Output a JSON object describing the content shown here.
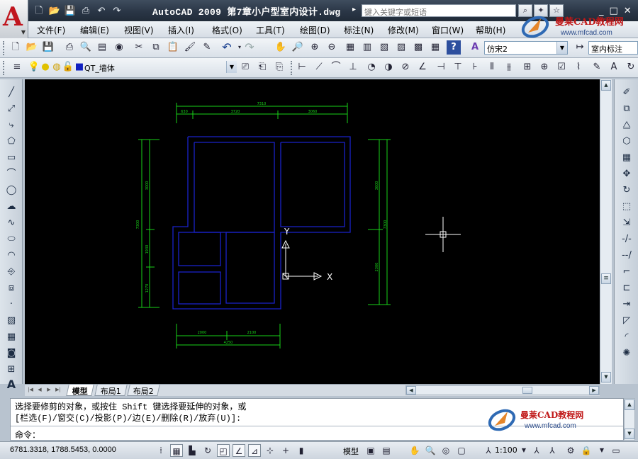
{
  "window": {
    "title": "AutoCAD  2009  第7章小户型室内设计.dwg",
    "search_placeholder": "键入关键字或短语",
    "controls": [
      "_",
      "□",
      "✕"
    ]
  },
  "menu": {
    "items": [
      "文件(F)",
      "编辑(E)",
      "视图(V)",
      "插入(I)",
      "格式(O)",
      "工具(T)",
      "绘图(D)",
      "标注(N)",
      "修改(M)",
      "窗口(W)",
      "帮助(H)"
    ]
  },
  "toolbars": {
    "font_combo": "仿宋2",
    "dimstyle_combo": "室内标注",
    "layer_combo": "QT_墙体"
  },
  "drawing": {
    "dim_top_total": "7310",
    "dim_top_parts": [
      "630",
      "3720",
      "3060"
    ],
    "dim_left_total": "7300",
    "dim_left_parts": [
      "3000",
      "1930",
      "1270"
    ],
    "dim_right_total": "7300",
    "dim_right_parts": [
      "3600",
      "2300"
    ],
    "dim_bottom_total": "4250",
    "dim_bottom_parts": [
      "2000",
      "2100"
    ],
    "ucs_y_label": "Y",
    "ucs_x_label": "X",
    "wall_color": "#1a22c8",
    "dim_color": "#19d219"
  },
  "layout_tabs": {
    "tabs": [
      "模型",
      "布局1",
      "布局2"
    ],
    "active": "模型"
  },
  "command": {
    "line1": "选择要修剪的对象，或按住 Shift 键选择要延伸的对象，或",
    "line2": "[栏选(F)/窗交(C)/投影(P)/边(E)/删除(R)/放弃(U)]:",
    "prompt": "命令："
  },
  "watermark": {
    "name": "曼莱CAD教程网",
    "url": "www.mfcad.com"
  },
  "status": {
    "coordinates": "6781.3318, 1788.5453, 0.0000",
    "model_label": "模型",
    "annotation_scale": "1:100"
  }
}
